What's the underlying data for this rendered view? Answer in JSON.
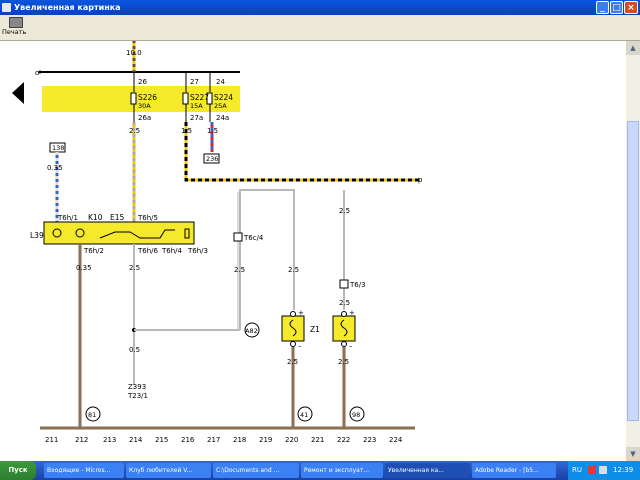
{
  "window": {
    "title": "Увеличенная картинка"
  },
  "toolbar": {
    "print_label": "Печать"
  },
  "diagram": {
    "bus_voltage": "10.0",
    "bus_terminal": "o",
    "fuses": [
      {
        "node": "26",
        "name": "S226",
        "rating": "30A",
        "out": "26a",
        "wire": "2.5"
      },
      {
        "node": "27",
        "name": "S227",
        "rating": "15A",
        "out": "27a",
        "wire": "1.5"
      },
      {
        "node": "24",
        "name": "S224",
        "rating": "25A",
        "out": "24a",
        "wire": "1.5"
      }
    ],
    "ref_236": "236",
    "ref_138": "138",
    "wire_035_top": "0.35",
    "ref_p": "p",
    "module": {
      "lamp_label": "L39",
      "k_label": "K10",
      "e_label": "E15",
      "pins": {
        "t6h1": "T6h/1",
        "t6h5": "T6h/5",
        "t6h2": "T6h/2",
        "t6h6": "T6h/6",
        "t6h4": "T6h/4",
        "t6h3": "T6h/3"
      }
    },
    "conn_t6c4": "T6c/4",
    "conn_t63": "T6/3",
    "wire_25a": "2.5",
    "wire_25b": "2.5",
    "wire_25c": "2.5",
    "wire_25d": "2.5",
    "wire_25e": "2.5",
    "wire_25f": "2.5",
    "wire_25g": "2.5",
    "wire_035_bottom": "0.35",
    "wire_05": "0.5",
    "node_a82": "A82",
    "z1_label": "Z1",
    "z393": "Z393",
    "t231": "T23/1",
    "plus": "+",
    "minus": "–",
    "ground_81": "81",
    "ground_41": "41",
    "ground_98": "98",
    "ruler": [
      "211",
      "212",
      "213",
      "214",
      "215",
      "216",
      "217",
      "218",
      "219",
      "220",
      "221",
      "222",
      "223",
      "224"
    ]
  },
  "taskbar": {
    "start": "Пуск",
    "tasks": [
      "Входящие - Micros...",
      "Клуб любителей V...",
      "C:\\Documents and ...",
      "Ремонт и эксплуат...",
      "Увеличенная ка...",
      "Adobe Reader - [b5..."
    ],
    "lang": "RU",
    "clock": "12:39"
  },
  "colors": {
    "fuse_bar": "#f5e92c",
    "wire_brown": "#8b6f52",
    "titlebar": "#0842b8"
  }
}
